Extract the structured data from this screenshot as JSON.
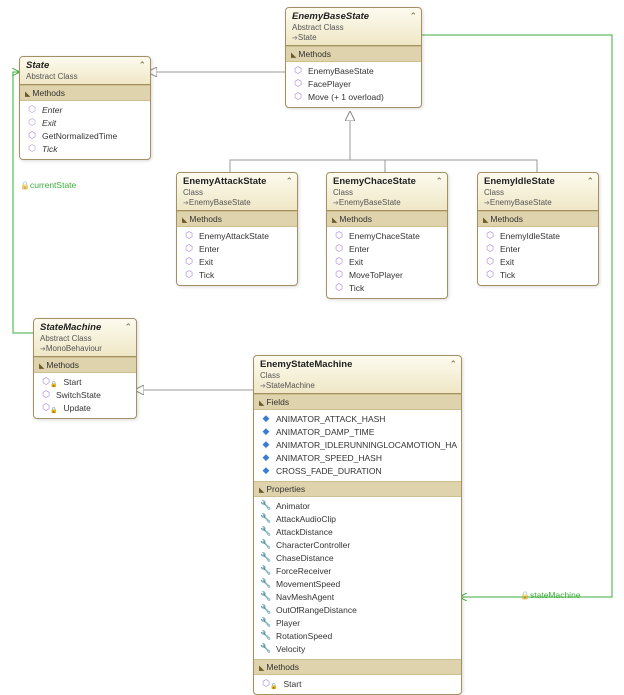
{
  "boxes": {
    "state": {
      "title": "State",
      "kind": "Abstract Class",
      "inherits": null,
      "sections": [
        {
          "name": "Methods",
          "items": [
            {
              "icon": "amethod",
              "label": "Enter",
              "italic": true
            },
            {
              "icon": "amethod",
              "label": "Exit",
              "italic": true
            },
            {
              "icon": "method",
              "label": "GetNormalizedTime"
            },
            {
              "icon": "amethod",
              "label": "Tick",
              "italic": true
            }
          ]
        }
      ]
    },
    "enemyBaseState": {
      "title": "EnemyBaseState",
      "kind": "Abstract Class",
      "inherits": "State",
      "sections": [
        {
          "name": "Methods",
          "items": [
            {
              "icon": "method",
              "label": "EnemyBaseState"
            },
            {
              "icon": "method",
              "label": "FacePlayer"
            },
            {
              "icon": "method",
              "label": "Move (+ 1 overload)"
            }
          ]
        }
      ]
    },
    "enemyAttack": {
      "title": "EnemyAttackState",
      "kind": "Class",
      "inherits": "EnemyBaseState",
      "sections": [
        {
          "name": "Methods",
          "items": [
            {
              "icon": "method",
              "label": "EnemyAttackState"
            },
            {
              "icon": "method",
              "label": "Enter"
            },
            {
              "icon": "method",
              "label": "Exit"
            },
            {
              "icon": "method",
              "label": "Tick"
            }
          ]
        }
      ]
    },
    "enemyChace": {
      "title": "EnemyChaceState",
      "kind": "Class",
      "inherits": "EnemyBaseState",
      "sections": [
        {
          "name": "Methods",
          "items": [
            {
              "icon": "method",
              "label": "EnemyChaceState"
            },
            {
              "icon": "method",
              "label": "Enter"
            },
            {
              "icon": "method",
              "label": "Exit"
            },
            {
              "icon": "method",
              "label": "MoveToPlayer"
            },
            {
              "icon": "method",
              "label": "Tick"
            }
          ]
        }
      ]
    },
    "enemyIdle": {
      "title": "EnemyIdleState",
      "kind": "Class",
      "inherits": "EnemyBaseState",
      "sections": [
        {
          "name": "Methods",
          "items": [
            {
              "icon": "method",
              "label": "EnemyIdleState"
            },
            {
              "icon": "method",
              "label": "Enter"
            },
            {
              "icon": "method",
              "label": "Exit"
            },
            {
              "icon": "method",
              "label": "Tick"
            }
          ]
        }
      ]
    },
    "stateMachine": {
      "title": "StateMachine",
      "kind": "Abstract Class",
      "inherits": "MonoBehaviour",
      "sections": [
        {
          "name": "Methods",
          "items": [
            {
              "icon": "method",
              "label": "Start",
              "lock": true
            },
            {
              "icon": "method",
              "label": "SwitchState"
            },
            {
              "icon": "method",
              "label": "Update",
              "lock": true
            }
          ]
        }
      ]
    },
    "enemyStateMachine": {
      "title": "EnemyStateMachine",
      "kind": "Class",
      "inherits": "StateMachine",
      "sections": [
        {
          "name": "Fields",
          "items": [
            {
              "icon": "field",
              "label": "ANIMATOR_ATTACK_HASH"
            },
            {
              "icon": "field",
              "label": "ANIMATOR_DAMP_TIME"
            },
            {
              "icon": "field",
              "label": "ANIMATOR_IDLERUNNINGLOCAMOTION_HASH"
            },
            {
              "icon": "field",
              "label": "ANIMATOR_SPEED_HASH"
            },
            {
              "icon": "field",
              "label": "CROSS_FADE_DURATION"
            }
          ]
        },
        {
          "name": "Properties",
          "items": [
            {
              "icon": "prop",
              "label": "Animator"
            },
            {
              "icon": "prop",
              "label": "AttackAudioClip"
            },
            {
              "icon": "prop",
              "label": "AttackDistance"
            },
            {
              "icon": "prop",
              "label": "CharacterController"
            },
            {
              "icon": "prop",
              "label": "ChaseDistance"
            },
            {
              "icon": "prop",
              "label": "ForceReceiver"
            },
            {
              "icon": "prop",
              "label": "MovementSpeed"
            },
            {
              "icon": "prop",
              "label": "NavMeshAgent"
            },
            {
              "icon": "prop",
              "label": "OutOfRangeDistance"
            },
            {
              "icon": "prop",
              "label": "Player"
            },
            {
              "icon": "prop",
              "label": "RotationSpeed"
            },
            {
              "icon": "prop",
              "label": "Velocity"
            }
          ]
        },
        {
          "name": "Methods",
          "items": [
            {
              "icon": "method",
              "label": "Start",
              "lock": true
            }
          ]
        }
      ]
    }
  },
  "labels": {
    "currentState": "currentState",
    "stateMachine": "stateMachine"
  }
}
